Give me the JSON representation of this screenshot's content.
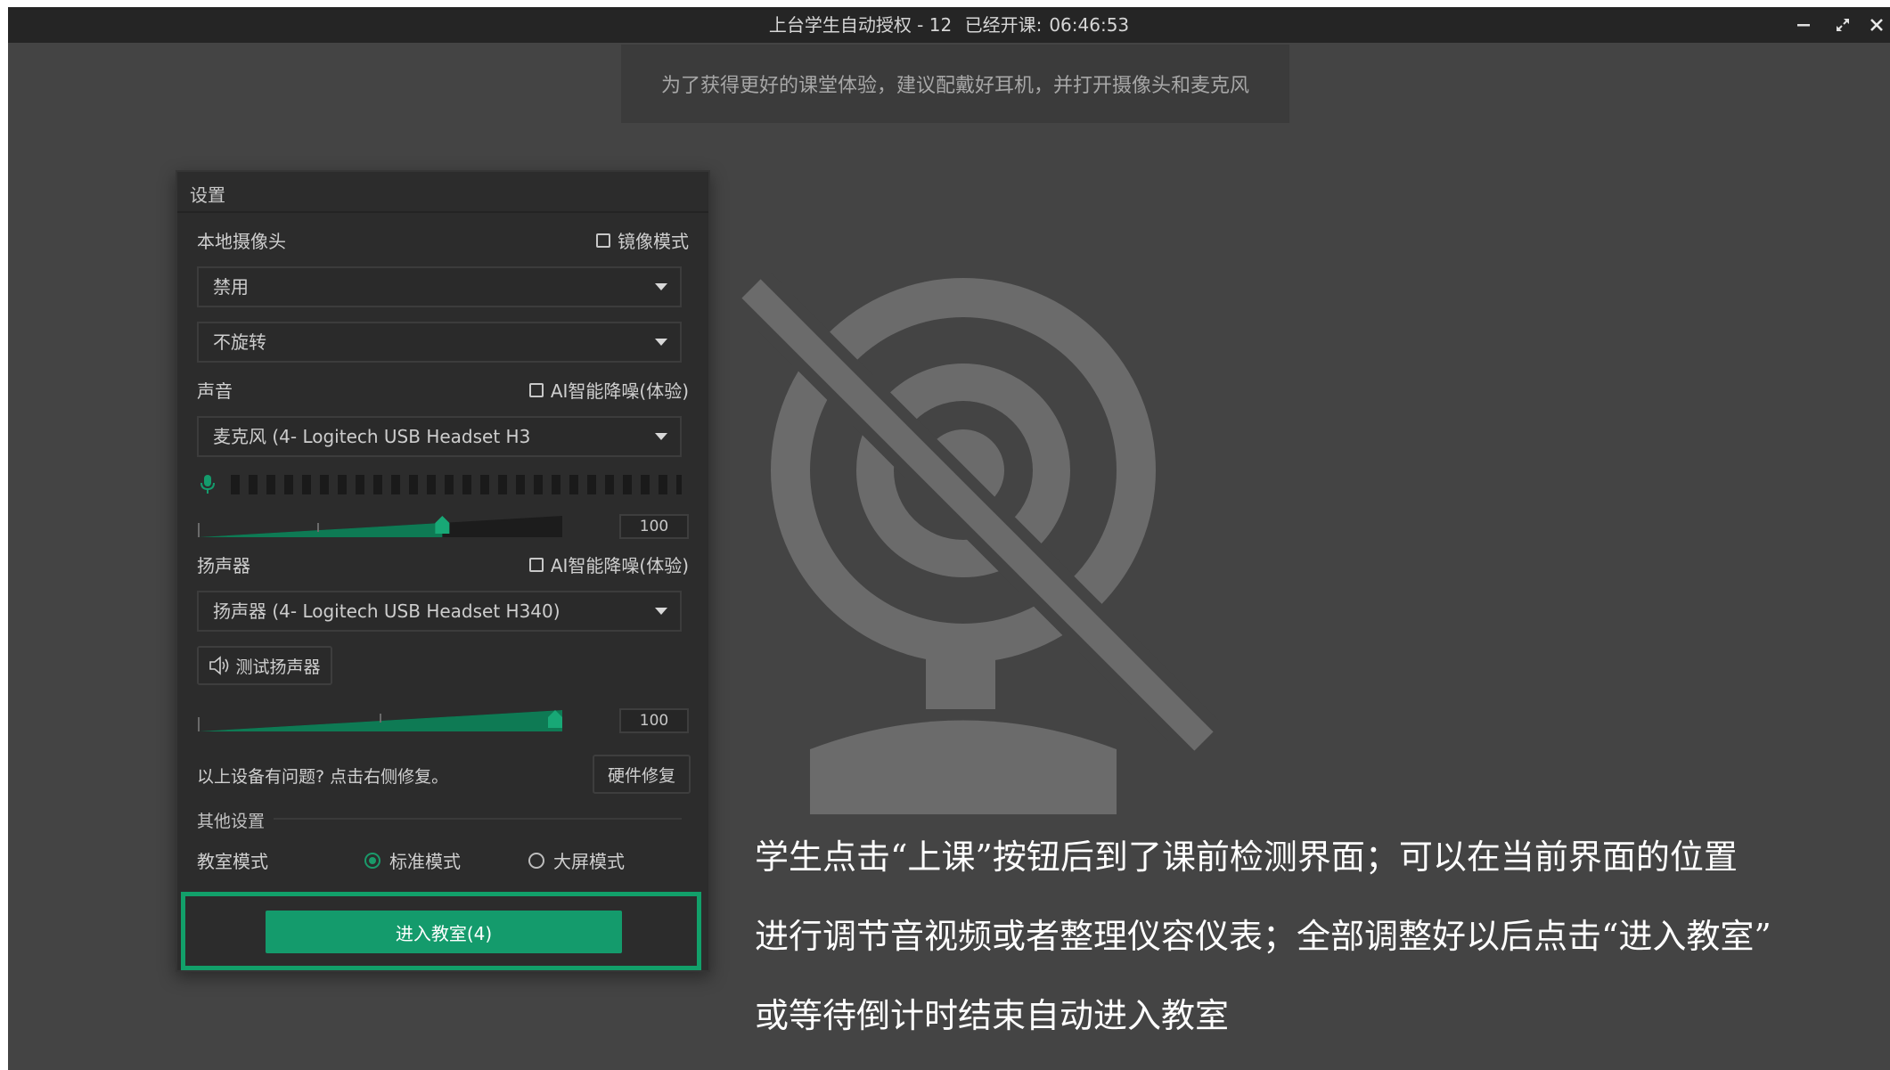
{
  "window": {
    "title": "上台学生自动授权 - 12",
    "elapsed_label": "已经开课:",
    "elapsed_time": "06:46:53"
  },
  "tip": "为了获得更好的课堂体验，建议配戴好耳机，并打开摄像头和麦克风",
  "settings": {
    "title": "设置",
    "camera": {
      "label": "本地摄像头",
      "mirror_label": "镜像模式",
      "mirror_checked": false,
      "device": "禁用",
      "rotation": "不旋转"
    },
    "microphone": {
      "label": "声音",
      "ai_denoise_label": "AI智能降噪(体验)",
      "ai_denoise_checked": false,
      "device": "麦克风 (4- Logitech USB Headset H3",
      "volume": "100",
      "slider_level": 0.67
    },
    "speaker": {
      "label": "扬声器",
      "ai_denoise_label": "AI智能降噪(体验)",
      "ai_denoise_checked": false,
      "device": "扬声器 (4- Logitech USB Headset H340)",
      "test_button": "测试扬声器",
      "volume": "100",
      "slider_level": 1.0
    },
    "repair": {
      "hint": "以上设备有问题? 点击右侧修复。",
      "button": "硬件修复"
    },
    "other": {
      "label": "其他设置",
      "mode_label": "教室模式",
      "mode_standard": "标准模式",
      "mode_large": "大屏模式",
      "selected": "标准模式"
    },
    "enter_button": "进入教室(4)"
  },
  "colors": {
    "accent": "#149b6c",
    "highlight_frame": "#12a06a"
  },
  "caption": [
    "学生点击“上课”按钮后到了课前检测界面；可以在当前界面的位置",
    "进行调节音视频或者整理仪容仪表；全部调整好以后点击“进入教室”",
    "或等待倒计时结束自动进入教室"
  ]
}
